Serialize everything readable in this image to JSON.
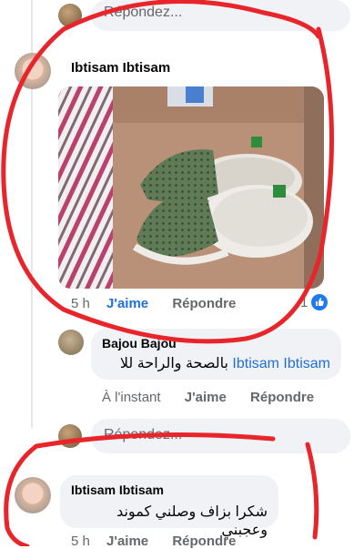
{
  "top_reply": {
    "placeholder": "Répondez..."
  },
  "comment1": {
    "author": "Ibtisam Ibtisam",
    "time": "5 h",
    "like_label": "J'aime",
    "reply_label": "Répondre",
    "reaction_count": "1",
    "reaction_icon": "thumbs-up-icon"
  },
  "reply1": {
    "author": "Bajou Bajou",
    "mention": "Ibtisam Ibtisam",
    "text": "بالصحة والراحة للا",
    "time": "À l'instant",
    "like_label": "J'aime",
    "reply_label": "Répondre"
  },
  "bottom_reply": {
    "placeholder": "Répondez..."
  },
  "comment2": {
    "author": "Ibtisam Ibtisam",
    "text": "شكرا بزاف وصلني كموند وعجبني",
    "time": "5 h",
    "like_label": "J'aime",
    "reply_label": "Répondre"
  },
  "colors": {
    "accent": "#216fdb",
    "bubble": "#f0f2f5",
    "annotation": "#e8252a",
    "muted": "#65676b"
  }
}
